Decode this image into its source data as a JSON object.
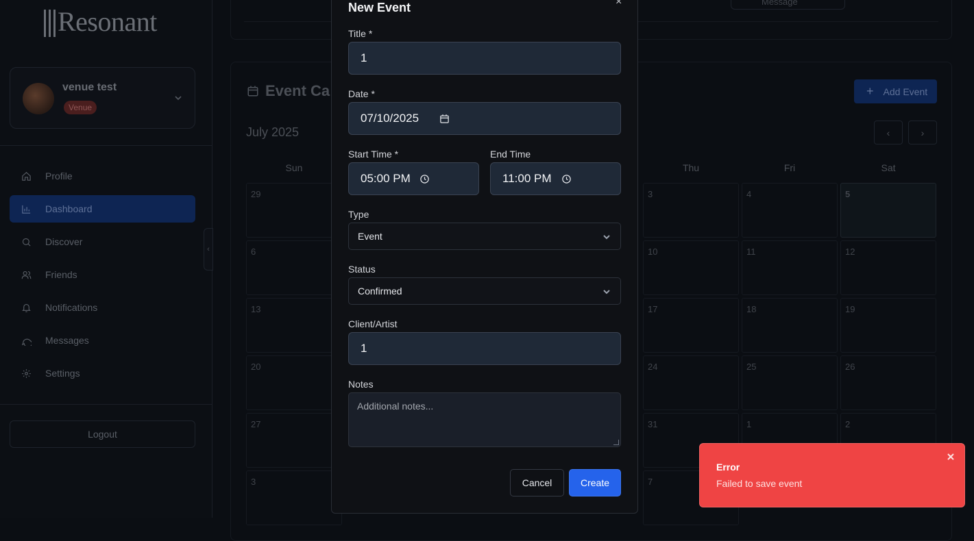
{
  "app": {
    "logo_text": "Resonant"
  },
  "sidebar": {
    "user": {
      "name": "venue test",
      "role_badge": "Venue"
    },
    "nav": [
      {
        "label": "Profile",
        "icon": "home-icon",
        "active": false
      },
      {
        "label": "Dashboard",
        "icon": "bar-chart-icon",
        "active": true
      },
      {
        "label": "Discover",
        "icon": "search-icon",
        "active": false
      },
      {
        "label": "Friends",
        "icon": "users-icon",
        "active": false
      },
      {
        "label": "Notifications",
        "icon": "bell-icon",
        "active": false
      },
      {
        "label": "Messages",
        "icon": "message-icon",
        "active": false
      },
      {
        "label": "Settings",
        "icon": "gear-icon",
        "active": false
      }
    ],
    "logout_label": "Logout"
  },
  "main": {
    "message_placeholder": "Message",
    "calendar": {
      "title": "Event Ca",
      "add_event_label": "Add Event",
      "month": "July 2025",
      "prev_label": "‹",
      "next_label": "›",
      "days_of_week": [
        "Sun",
        "Thu",
        "Fri",
        "Sat"
      ],
      "rows": [
        {
          "sun": "29",
          "thu": "3",
          "fri": "4",
          "sat": "5"
        },
        {
          "sun": "6",
          "thu": "10",
          "fri": "11",
          "sat": "12"
        },
        {
          "sun": "13",
          "thu": "17",
          "fri": "18",
          "sat": "19"
        },
        {
          "sun": "20",
          "thu": "24",
          "fri": "25",
          "sat": "26"
        },
        {
          "sun": "27",
          "thu": "31",
          "fri": "1",
          "sat": "2"
        },
        {
          "sun": "3",
          "thu": "7",
          "fri": "",
          "sat": ""
        }
      ]
    }
  },
  "modal": {
    "title": "New Event",
    "close_label": "×",
    "fields": {
      "title": {
        "label": "Title *",
        "value": "1"
      },
      "date": {
        "label": "Date *",
        "value": "07/10/2025"
      },
      "start_time": {
        "label": "Start Time *",
        "value": "05:00 PM"
      },
      "end_time": {
        "label": "End Time",
        "value": "11:00 PM"
      },
      "type": {
        "label": "Type",
        "value": "Event"
      },
      "status": {
        "label": "Status",
        "value": "Confirmed"
      },
      "client_artist": {
        "label": "Client/Artist",
        "value": "1"
      },
      "notes": {
        "label": "Notes",
        "placeholder": "Additional notes..."
      }
    },
    "cancel_label": "Cancel",
    "create_label": "Create"
  },
  "toast": {
    "title": "Error",
    "message": "Failed to save event",
    "color": "#ef4444"
  }
}
